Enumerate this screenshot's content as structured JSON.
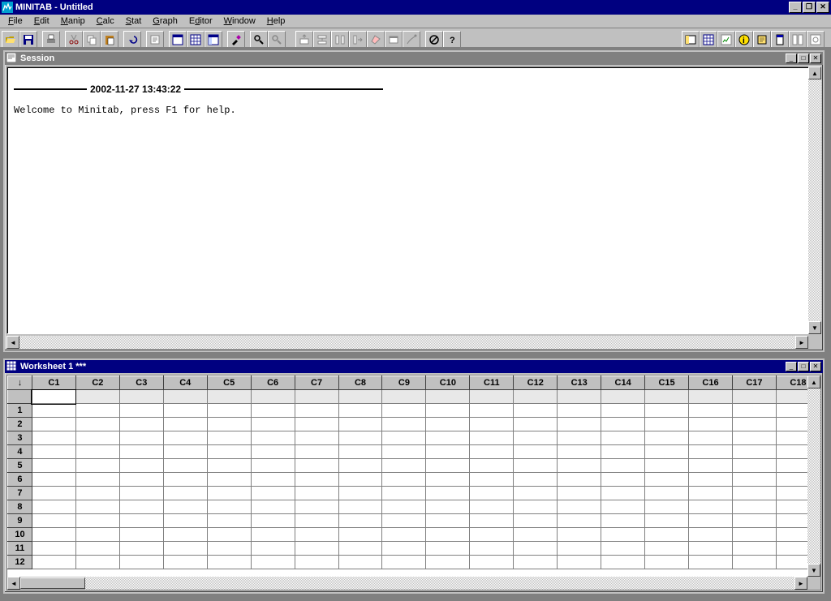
{
  "app": {
    "title": "MINITAB - Untitled"
  },
  "menu": {
    "items": [
      "File",
      "Edit",
      "Manip",
      "Calc",
      "Stat",
      "Graph",
      "Editor",
      "Window",
      "Help"
    ]
  },
  "session": {
    "title": "Session",
    "timestamp": "2002-11-27 13:43:22",
    "welcome": "Welcome to Minitab, press F1 for help."
  },
  "worksheet": {
    "title": "Worksheet 1 ***",
    "corner": "↓",
    "columns": [
      "C1",
      "C2",
      "C3",
      "C4",
      "C5",
      "C6",
      "C7",
      "C8",
      "C9",
      "C10",
      "C11",
      "C12",
      "C13",
      "C14",
      "C15",
      "C16",
      "C17",
      "C18"
    ],
    "rows": [
      "1",
      "2",
      "3",
      "4",
      "5",
      "6",
      "7",
      "8",
      "9",
      "10",
      "11",
      "12"
    ]
  },
  "chart_data": {
    "type": "table",
    "title": "Worksheet 1",
    "columns": [
      "C1",
      "C2",
      "C3",
      "C4",
      "C5",
      "C6",
      "C7",
      "C8",
      "C9",
      "C10",
      "C11",
      "C12",
      "C13",
      "C14",
      "C15",
      "C16",
      "C17",
      "C18"
    ],
    "rows": [
      [
        null,
        null,
        null,
        null,
        null,
        null,
        null,
        null,
        null,
        null,
        null,
        null,
        null,
        null,
        null,
        null,
        null,
        null
      ],
      [
        null,
        null,
        null,
        null,
        null,
        null,
        null,
        null,
        null,
        null,
        null,
        null,
        null,
        null,
        null,
        null,
        null,
        null
      ],
      [
        null,
        null,
        null,
        null,
        null,
        null,
        null,
        null,
        null,
        null,
        null,
        null,
        null,
        null,
        null,
        null,
        null,
        null
      ],
      [
        null,
        null,
        null,
        null,
        null,
        null,
        null,
        null,
        null,
        null,
        null,
        null,
        null,
        null,
        null,
        null,
        null,
        null
      ],
      [
        null,
        null,
        null,
        null,
        null,
        null,
        null,
        null,
        null,
        null,
        null,
        null,
        null,
        null,
        null,
        null,
        null,
        null
      ],
      [
        null,
        null,
        null,
        null,
        null,
        null,
        null,
        null,
        null,
        null,
        null,
        null,
        null,
        null,
        null,
        null,
        null,
        null
      ],
      [
        null,
        null,
        null,
        null,
        null,
        null,
        null,
        null,
        null,
        null,
        null,
        null,
        null,
        null,
        null,
        null,
        null,
        null
      ],
      [
        null,
        null,
        null,
        null,
        null,
        null,
        null,
        null,
        null,
        null,
        null,
        null,
        null,
        null,
        null,
        null,
        null,
        null
      ],
      [
        null,
        null,
        null,
        null,
        null,
        null,
        null,
        null,
        null,
        null,
        null,
        null,
        null,
        null,
        null,
        null,
        null,
        null
      ],
      [
        null,
        null,
        null,
        null,
        null,
        null,
        null,
        null,
        null,
        null,
        null,
        null,
        null,
        null,
        null,
        null,
        null,
        null
      ],
      [
        null,
        null,
        null,
        null,
        null,
        null,
        null,
        null,
        null,
        null,
        null,
        null,
        null,
        null,
        null,
        null,
        null,
        null
      ],
      [
        null,
        null,
        null,
        null,
        null,
        null,
        null,
        null,
        null,
        null,
        null,
        null,
        null,
        null,
        null,
        null,
        null,
        null
      ]
    ]
  }
}
